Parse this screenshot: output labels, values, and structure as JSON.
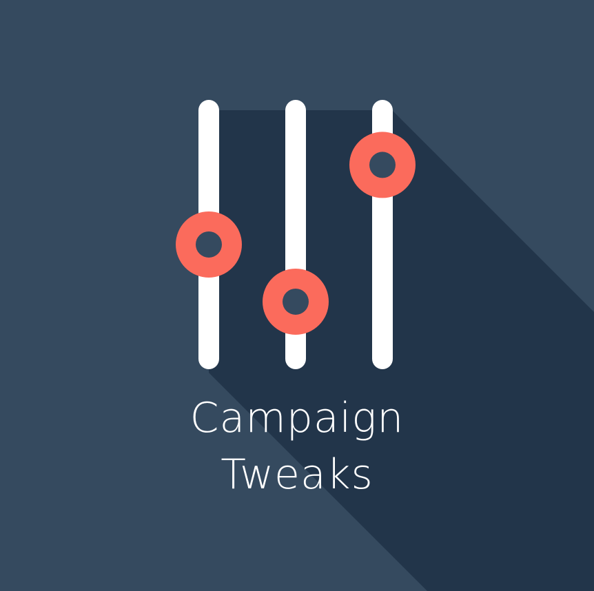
{
  "title": {
    "line1": "Campaign",
    "line2": "Tweaks"
  },
  "icon": {
    "name": "sliders-icon",
    "sliders": [
      {
        "level": 0.46
      },
      {
        "level": 0.23
      },
      {
        "level": 0.78
      }
    ]
  },
  "colors": {
    "background": "#354a5f",
    "shadow": "#22354a",
    "track": "#ffffff",
    "knob": "#fb6b5c"
  }
}
